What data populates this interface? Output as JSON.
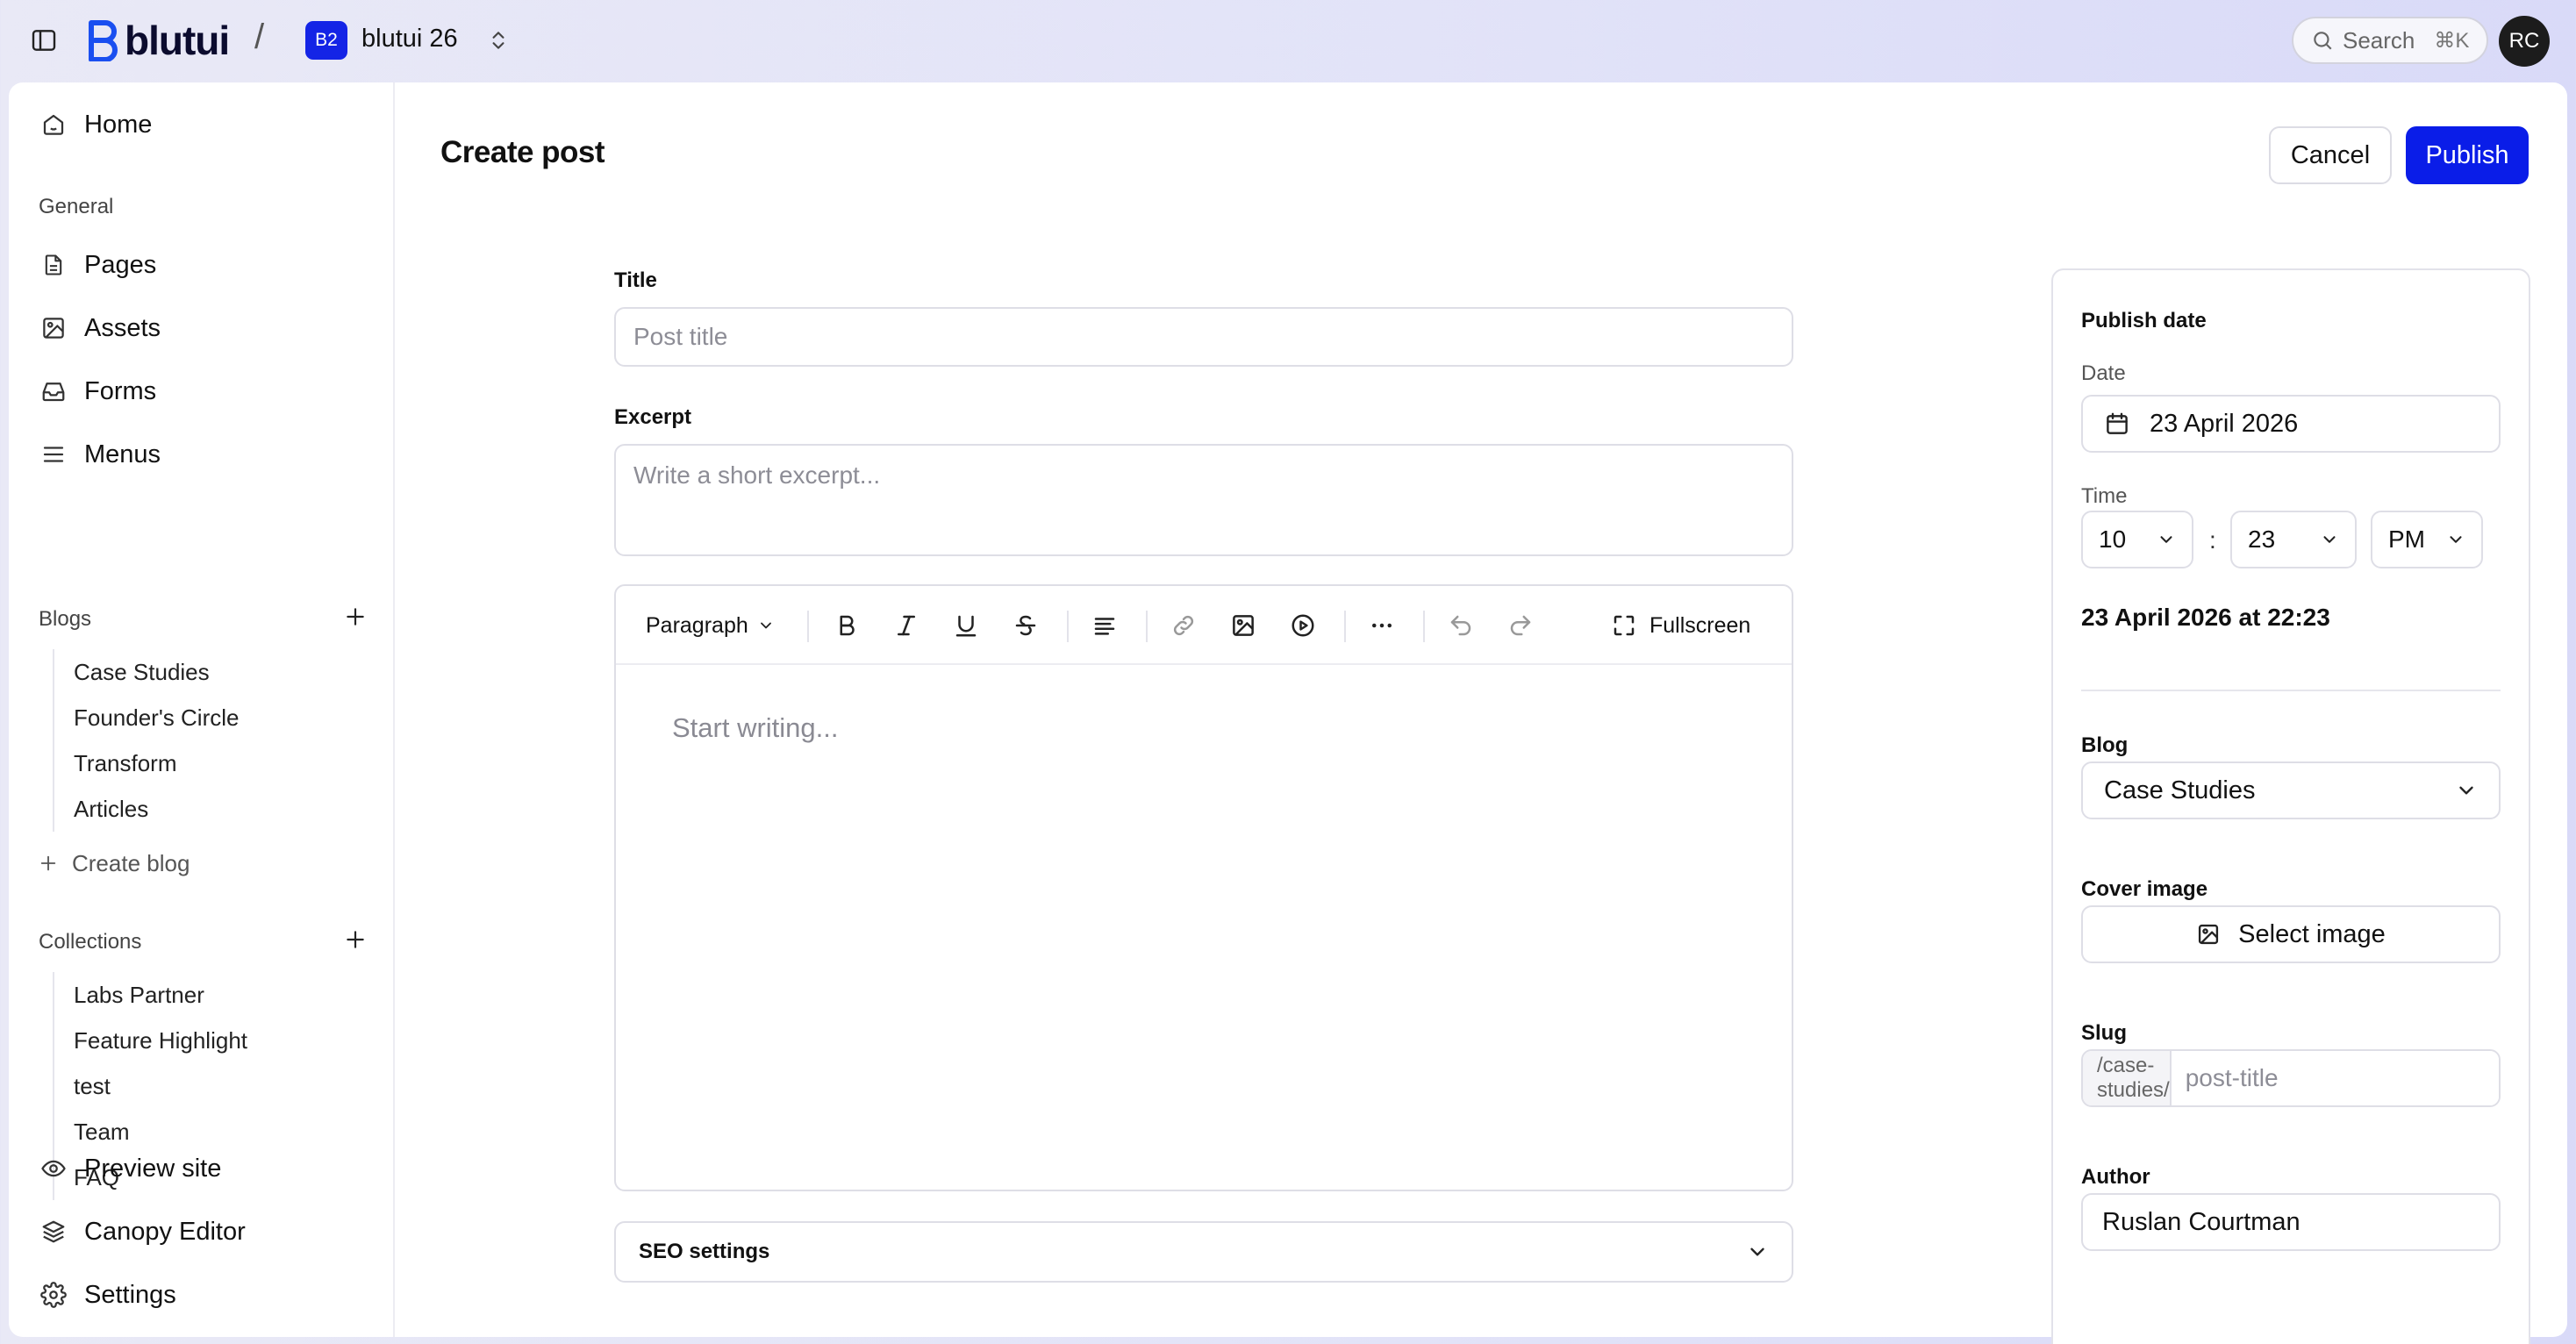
{
  "app": {
    "logo_text": "blutui",
    "workspace_badge": "B2",
    "workspace_name": "blutui 26",
    "search_label": "Search",
    "search_shortcut": "⌘K",
    "user_initials": "RC"
  },
  "sidebar": {
    "home": "Home",
    "general_heading": "General",
    "general_items": [
      "Pages",
      "Assets",
      "Forms",
      "Menus"
    ],
    "blogs_heading": "Blogs",
    "blogs": [
      "Case Studies",
      "Founder's Circle",
      "Transform",
      "Articles"
    ],
    "create_blog": "Create blog",
    "collections_heading": "Collections",
    "collections": [
      "Labs Partner",
      "Feature Highlight",
      "test",
      "Team",
      "FAQ"
    ],
    "bottom_items": [
      "Preview site",
      "Canopy Editor",
      "Settings"
    ]
  },
  "page": {
    "title": "Create post",
    "cancel_label": "Cancel",
    "publish_label": "Publish"
  },
  "form": {
    "title_label": "Title",
    "title_placeholder": "Post title",
    "excerpt_label": "Excerpt",
    "excerpt_placeholder": "Write a short excerpt...",
    "editor": {
      "block_type": "Paragraph",
      "fullscreen_label": "Fullscreen",
      "placeholder": "Start writing..."
    },
    "seo_label": "SEO settings"
  },
  "settings": {
    "publish_date_heading": "Publish date",
    "date_label": "Date",
    "date_value": "23 April 2026",
    "time_label": "Time",
    "hour": "10",
    "minute": "23",
    "meridiem": "PM",
    "time_separator": ":",
    "summary": "23 April 2026 at 22:23",
    "blog_label": "Blog",
    "blog_value": "Case Studies",
    "cover_label": "Cover image",
    "cover_button": "Select image",
    "slug_label": "Slug",
    "slug_prefix": "/case-studies/",
    "slug_placeholder": "post-title",
    "author_label": "Author",
    "author_value": "Ruslan Courtman"
  },
  "colors": {
    "accent": "#0a1de8",
    "badge": "#1424e6",
    "avatar_bg": "#1c1c1c"
  }
}
